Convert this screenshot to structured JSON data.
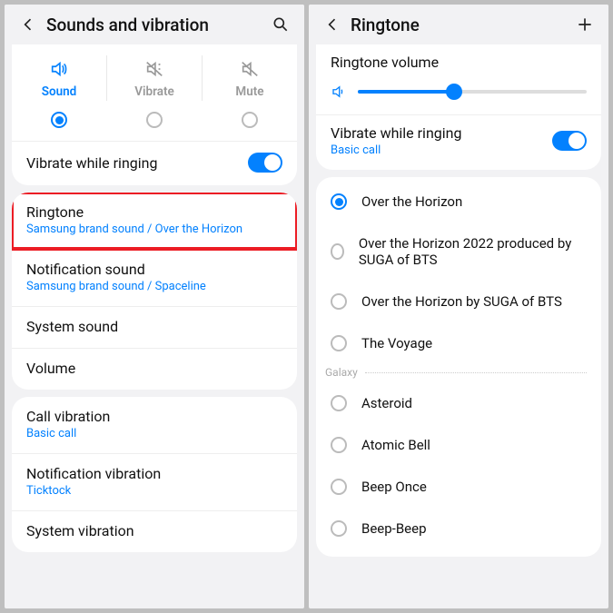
{
  "left": {
    "title": "Sounds and vibration",
    "modes": {
      "sound": "Sound",
      "vibrate": "Vibrate",
      "mute": "Mute"
    },
    "vibrate_while_ringing": "Vibrate while ringing",
    "ringtone": {
      "title": "Ringtone",
      "sub": "Samsung brand sound / Over the Horizon"
    },
    "notification_sound": {
      "title": "Notification sound",
      "sub": "Samsung brand sound / Spaceline"
    },
    "system_sound": "System sound",
    "volume": "Volume",
    "call_vibration": {
      "title": "Call vibration",
      "sub": "Basic call"
    },
    "notification_vibration": {
      "title": "Notification vibration",
      "sub": "Ticktock"
    },
    "system_vibration": "System vibration"
  },
  "right": {
    "title": "Ringtone",
    "volume_title": "Ringtone volume",
    "vibrate_while_ringing": {
      "title": "Vibrate while ringing",
      "sub": "Basic call"
    },
    "section_label": "Galaxy",
    "top_list": [
      "Over the Horizon",
      "Over the Horizon 2022 produced by SUGA of BTS",
      "Over the Horizon by SUGA of BTS",
      "The Voyage"
    ],
    "galaxy_list": [
      "Asteroid",
      "Atomic Bell",
      "Beep Once",
      "Beep-Beep"
    ]
  }
}
